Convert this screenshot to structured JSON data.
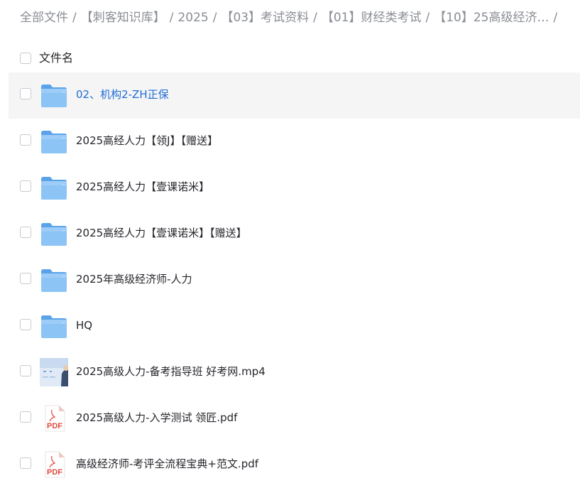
{
  "breadcrumb": [
    "全部文件",
    "【刺客知识库】",
    "2025",
    "【03】考试资料",
    "【01】财经类考试",
    "【10】25高级经济…"
  ],
  "breadcrumb_separator": "/",
  "header": {
    "column_label": "文件名"
  },
  "files": [
    {
      "name": "02、机构2-ZH正保",
      "type": "folder",
      "selected": true
    },
    {
      "name": "2025高经人力【领J】【赠送】",
      "type": "folder"
    },
    {
      "name": "2025高经人力【壹课诺米】",
      "type": "folder"
    },
    {
      "name": "2025高经人力【壹课诺米】【赠送】",
      "type": "folder"
    },
    {
      "name": "2025年高级经济师-人力",
      "type": "folder"
    },
    {
      "name": "HQ",
      "type": "folder"
    },
    {
      "name": "2025高级人力-备考指导班 好考网.mp4",
      "type": "video"
    },
    {
      "name": "2025高级人力-入学测试 领匠.pdf",
      "type": "pdf"
    },
    {
      "name": "高级经济师-考评全流程宝典+范文.pdf",
      "type": "pdf"
    }
  ],
  "pdf_label": "PDF",
  "colors": {
    "link_blue": "#1f6cd6",
    "folder_blue": "#7ab8f2",
    "pdf_red": "#e04b40",
    "row_hover": "#f5f5f6"
  }
}
